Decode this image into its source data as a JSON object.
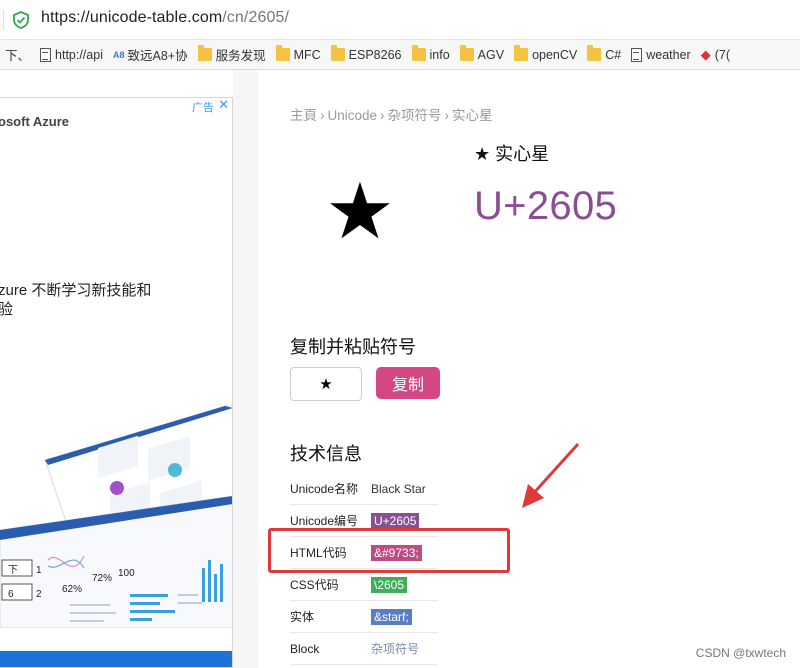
{
  "browser": {
    "url_host": "https://unicode-table.com",
    "url_path": "/cn/2605/",
    "bookmarks": [
      {
        "label": "下、",
        "icon": "none"
      },
      {
        "label": "http://api",
        "icon": "page-icon"
      },
      {
        "label": "致远A8+协",
        "icon": "a8-icon"
      },
      {
        "label": "服务发现",
        "icon": "folder-icon"
      },
      {
        "label": "MFC",
        "icon": "folder-icon"
      },
      {
        "label": "ESP8266",
        "icon": "folder-icon"
      },
      {
        "label": "info",
        "icon": "folder-icon"
      },
      {
        "label": "AGV",
        "icon": "folder-icon"
      },
      {
        "label": "openCV",
        "icon": "folder-icon"
      },
      {
        "label": "C#",
        "icon": "folder-icon"
      },
      {
        "label": "weather",
        "icon": "page-icon"
      },
      {
        "label": "(7(",
        "icon": "red-icon"
      }
    ]
  },
  "ad": {
    "brand": "osoft Azure",
    "label": "广告",
    "close": "✕",
    "headline_line1": "zure 不断学习新技能和",
    "headline_line2": "验"
  },
  "breadcrumb": [
    "主頁",
    "Unicode",
    "杂项符号",
    "实心星"
  ],
  "breadcrumb_sep": "›",
  "symbol": {
    "glyph": "★",
    "title": "★ 实心星",
    "codepoint": "U+2605"
  },
  "copy": {
    "title": "复制并粘贴符号",
    "value": "★",
    "button": "复制"
  },
  "tech": {
    "title": "技术信息",
    "rows": [
      {
        "key": "Unicode名称",
        "value": "Black Star",
        "tag_color": ""
      },
      {
        "key": "Unicode编号",
        "value": "U+2605",
        "tag_color": "#8b4e93"
      },
      {
        "key": "HTML代码",
        "value": "&#9733;",
        "tag_color": "#c04a86"
      },
      {
        "key": "CSS代码",
        "value": "\\2605",
        "tag_color": "#3fae58"
      },
      {
        "key": "实体",
        "value": "&starf;",
        "tag_color": "#5a7fc0"
      },
      {
        "key": "Block",
        "value": "杂项符号",
        "tag_color": ""
      }
    ]
  },
  "colors": {
    "accent": "#8b4e93",
    "button": "#d24784",
    "annotation": "#e0393a"
  },
  "watermark": "CSDN @txwtech"
}
